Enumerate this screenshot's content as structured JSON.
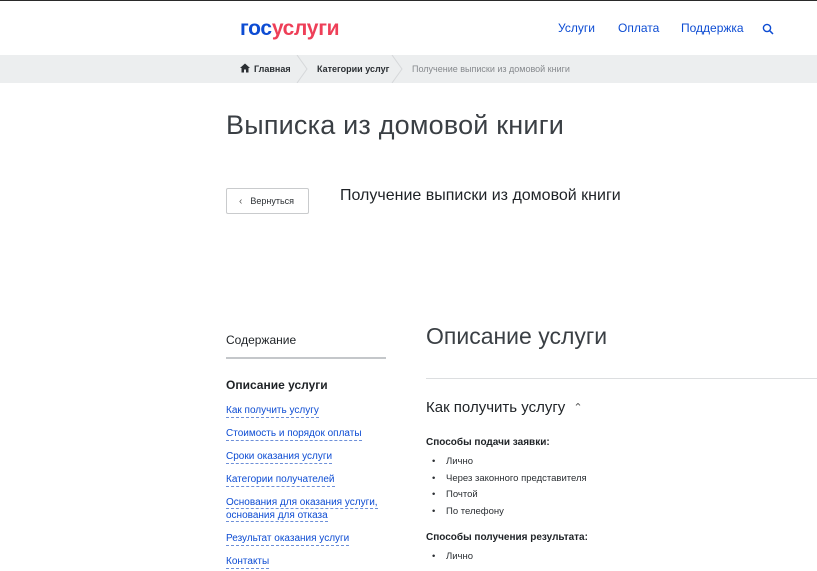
{
  "header": {
    "logo_part1": "гос",
    "logo_part2": "услуги",
    "nav": [
      "Услуги",
      "Оплата",
      "Поддержка"
    ],
    "search_icon": "search-icon"
  },
  "breadcrumb": {
    "items": [
      "Главная",
      "Категории услуг",
      "Получение выписки из домовой книги"
    ]
  },
  "page": {
    "title": "Выписка из домовой книги",
    "back_label": "Вернуться",
    "subtitle": "Получение выписки из домовой книги"
  },
  "toc": {
    "heading": "Содержание",
    "active": "Описание услуги",
    "links": [
      "Как получить услугу",
      "Стоимость и порядок оплаты",
      "Сроки оказания услуги",
      "Категории получателей",
      "Основания для оказания услуги,",
      "основания для отказа",
      "Результат оказания услуги",
      "Контакты"
    ]
  },
  "content": {
    "section_title": "Описание услуги",
    "how_heading": "Как получить услугу",
    "submit_heading": "Способы подачи заявки:",
    "submit_methods": [
      "Лично",
      "Через законного представителя",
      "Почтой",
      "По телефону"
    ],
    "result_heading": "Способы получения результата:",
    "result_methods": [
      "Лично"
    ]
  },
  "colors": {
    "brand_blue": "#0d4cd3",
    "brand_red": "#ee3f58",
    "breadcrumb_bg": "#eceeef"
  }
}
